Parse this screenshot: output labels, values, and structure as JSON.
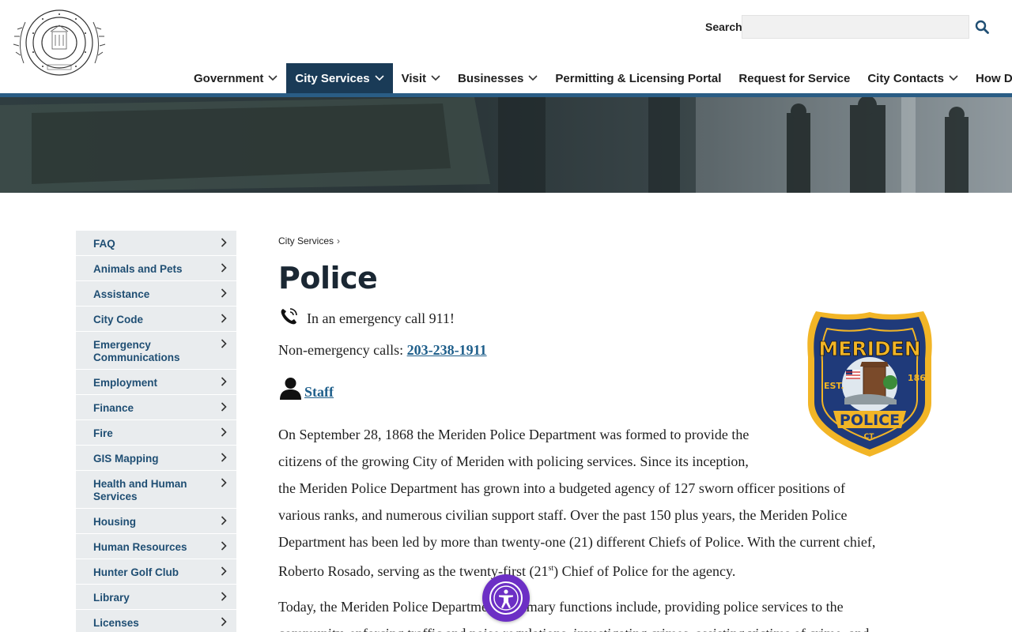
{
  "header": {
    "logo_alt": "City of Meriden seal",
    "search_label": "Search",
    "search_placeholder": ""
  },
  "nav": {
    "items": [
      {
        "label": "Government",
        "has_dropdown": true,
        "active": false
      },
      {
        "label": "City Services",
        "has_dropdown": true,
        "active": true
      },
      {
        "label": "Visit",
        "has_dropdown": true,
        "active": false
      },
      {
        "label": "Businesses",
        "has_dropdown": true,
        "active": false
      },
      {
        "label": "Permitting & Licensing Portal",
        "has_dropdown": false,
        "active": false
      },
      {
        "label": "Request for Service",
        "has_dropdown": false,
        "active": false
      },
      {
        "label": "City Contacts",
        "has_dropdown": true,
        "active": false
      },
      {
        "label": "How Do I?",
        "has_dropdown": true,
        "active": false
      }
    ]
  },
  "sidebar": {
    "items": [
      {
        "label": "FAQ"
      },
      {
        "label": "Animals and Pets"
      },
      {
        "label": "Assistance"
      },
      {
        "label": "City Code"
      },
      {
        "label": "Emergency Communications"
      },
      {
        "label": "Employment"
      },
      {
        "label": "Finance"
      },
      {
        "label": "Fire"
      },
      {
        "label": "GIS Mapping"
      },
      {
        "label": "Health and Human Services"
      },
      {
        "label": "Housing"
      },
      {
        "label": "Human Resources"
      },
      {
        "label": "Hunter Golf Club"
      },
      {
        "label": "Library"
      },
      {
        "label": "Licenses"
      }
    ]
  },
  "main": {
    "breadcrumb": "City Services",
    "breadcrumb_sep": "›",
    "title": "Police",
    "emergency_text": "In an emergency call 911!",
    "nonemergency_prefix": "Non-emergency calls: ",
    "nonemergency_phone": "203-238-1911",
    "staff_link": "Staff",
    "para1_a": "On September 28, 1868 the Meriden Police Department was formed to provide the",
    "para1_b": "citizens of the growing City of Meriden with policing services.  Since its inception,",
    "para1_c": "the Meriden Police Department has grown into a budgeted agency of 127 sworn officer positions of",
    "para1_d": "various ranks, and numerous civilian support staff.  Over the past 150 plus years, the Meriden Police",
    "para1_e": "Department has been led by more than twenty-one (21) different Chiefs of Police. With the current chief,",
    "para1_f_pre": "Roberto Rosado, serving as the twenty-first (21",
    "para1_f_sup": "st",
    "para1_f_post": ") Chief of Police for the agency.",
    "para2_a": "Today, the Meriden Police Department's primary functions include, providing police services to the",
    "para2_b": "community, enforcing traffic and noise regulations, investigating crimes, assisting victims of crime, and"
  },
  "badge": {
    "top_text": "MERIDEN",
    "bottom_text": "POLICE",
    "est": "EST.",
    "year": "1868",
    "state": "CT."
  },
  "colors": {
    "nav_active": "#1a3b57",
    "nav_rule": "#2a5d85",
    "link": "#1f5f8b",
    "sidebar_bg": "#e9ecee",
    "sidebar_text": "#1f4e73",
    "accessibility": "#6c2fc5"
  }
}
